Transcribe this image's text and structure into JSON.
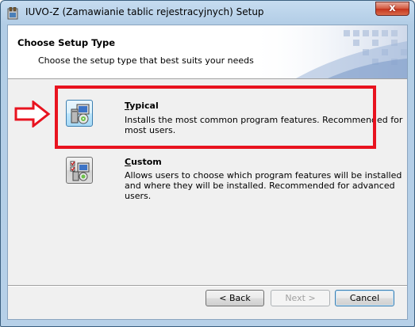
{
  "window": {
    "title": "IUVO-Z (Zamawianie tablic rejestracyjnych) Setup",
    "close_glyph": "x"
  },
  "header": {
    "title": "Choose Setup Type",
    "subtitle": "Choose the setup type that best suits your needs"
  },
  "options": [
    {
      "icon": "typical-install-icon",
      "title": "Typical",
      "description_lines": [
        "Installs the most common program features. Recommended for",
        "most users."
      ]
    },
    {
      "icon": "custom-install-icon",
      "title": "Custom",
      "description_lines": [
        "Allows users to choose which program features will be installed",
        "and where they will be installed. Recommended for advanced",
        "users."
      ]
    }
  ],
  "buttons": {
    "back": "< Back",
    "next": "Next >",
    "cancel": "Cancel"
  },
  "annotation": {
    "color": "#e8131f"
  }
}
